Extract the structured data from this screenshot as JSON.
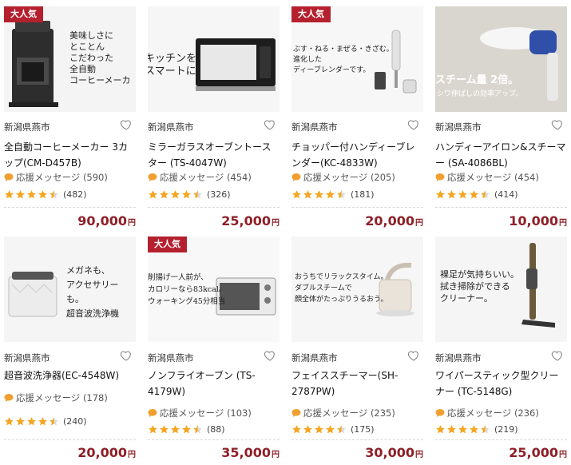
{
  "products": [
    {
      "badge": "大人気",
      "thumb_text": "美味しさに\nとことん\nこだわった\n全自動\nコーヒーメーカ",
      "region": "新潟県燕市",
      "title": "全自動コーヒーメーカー 3カップ(CM-D457B)",
      "message_label": "応援メッセージ",
      "message_count": "(590)",
      "rating": 4.5,
      "review_count": "(482)",
      "price": "90,000",
      "yen": "円"
    },
    {
      "badge": "",
      "thumb_text": "キッチンを\nスマートに。",
      "region": "新潟県燕市",
      "title": "ミラーガラスオーブントースター (TS-4047W)",
      "message_label": "応援メッセージ",
      "message_count": "(454)",
      "rating": 4.5,
      "review_count": "(326)",
      "price": "25,000",
      "yen": "円"
    },
    {
      "badge": "大人気",
      "thumb_text": "ぶす・ねる・まぜる・きざむ。\n進化した\nディーブレンダーです。",
      "region": "新潟県燕市",
      "title": "チョッパー付ハンディーブレンダー(KC-4833W)",
      "message_label": "応援メッセージ",
      "message_count": "(205)",
      "rating": 4.5,
      "review_count": "(181)",
      "price": "20,000",
      "yen": "円"
    },
    {
      "badge": "",
      "thumb_text": "スチーム量 2倍。",
      "thumb_subtext": "シワ伸ばしの効率アップ。",
      "region": "新潟県燕市",
      "title": "ハンディーアイロン&スチーマー (SA-4086BL)",
      "message_label": "応援メッセージ",
      "message_count": "(454)",
      "rating": 4.5,
      "review_count": "(414)",
      "price": "10,000",
      "yen": "円"
    },
    {
      "badge": "",
      "thumb_text": "メガネも、\nアクセサリーも。\n超音波洗浄機",
      "region": "新潟県燕市",
      "title": "超音波洗浄器(EC-4548W)",
      "message_label": "応援メッセージ",
      "message_count": "(178)",
      "rating": 4.5,
      "review_count": "(240)",
      "price": "20,000",
      "yen": "円"
    },
    {
      "badge": "大人気",
      "thumb_text": "削揚げ一人前が、\nカロリーなら83kcal。\nウォーキング45分相当",
      "region": "新潟県燕市",
      "title": "ノンフライオーブン (TS-4179W)",
      "message_label": "応援メッセージ",
      "message_count": "(103)",
      "rating": 4.5,
      "review_count": "(88)",
      "price": "35,000",
      "yen": "円"
    },
    {
      "badge": "",
      "thumb_text": "おうちでリラックスタイム。\nダブルスチームで\n顔全体がたっぷりうるおう。",
      "region": "新潟県燕市",
      "title": "フェイススチーマー(SH-2787PW)",
      "message_label": "応援メッセージ",
      "message_count": "(235)",
      "rating": 4.5,
      "review_count": "(175)",
      "price": "30,000",
      "yen": "円"
    },
    {
      "badge": "",
      "thumb_text": "裸足が気持ちいい。\n拭き掃除ができる\nクリーナー。",
      "region": "新潟県燕市",
      "title": "ワイパースティック型クリーナー (TC-5148G)",
      "message_label": "応援メッセージ",
      "message_count": "(236)",
      "rating": 4.5,
      "review_count": "(219)",
      "price": "25,000",
      "yen": "円"
    }
  ],
  "colors": {
    "badge": "#b5202e",
    "price": "#8e1f27",
    "star": "#f5a623",
    "bubble": "#f0a030"
  }
}
